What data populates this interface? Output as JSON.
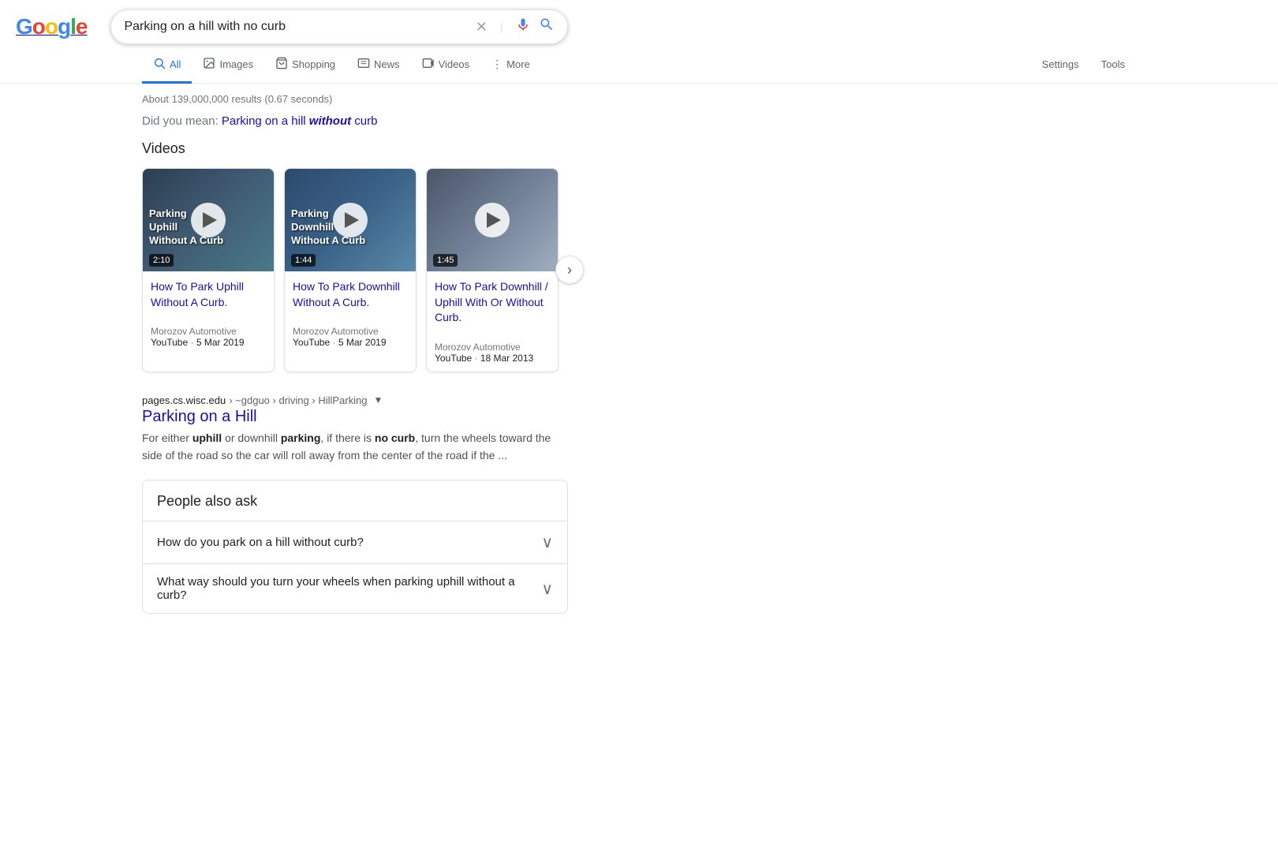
{
  "logo": {
    "letters": [
      "G",
      "o",
      "o",
      "g",
      "l",
      "e"
    ]
  },
  "search": {
    "query": "Parking on a hill with no curb",
    "placeholder": "Search"
  },
  "nav": {
    "items": [
      {
        "label": "All",
        "icon": "🔍",
        "active": true
      },
      {
        "label": "Images",
        "icon": "🖼",
        "active": false
      },
      {
        "label": "Shopping",
        "icon": "🏷",
        "active": false
      },
      {
        "label": "News",
        "icon": "📰",
        "active": false
      },
      {
        "label": "Videos",
        "icon": "▶",
        "active": false
      },
      {
        "label": "More",
        "icon": "⋮",
        "active": false
      }
    ],
    "settings": "Settings",
    "tools": "Tools"
  },
  "results_count": "About 139,000,000 results (0.67 seconds)",
  "did_you_mean": {
    "prefix": "Did you mean:",
    "query_start": "Parking on a hill ",
    "query_bold": "without",
    "query_end": " curb"
  },
  "videos_section": {
    "title": "Videos",
    "cards": [
      {
        "title": "How To Park Uphill Without A Curb.",
        "duration": "2:10",
        "source": "Morozov Automotive",
        "platform": "YouTube",
        "date": "5 Mar 2019",
        "thumb_label1": "Parking",
        "thumb_label2": "Uphill",
        "thumb_label3": "Without A Curb"
      },
      {
        "title": "How To Park Downhill Without A Curb.",
        "duration": "1:44",
        "source": "Morozov Automotive",
        "platform": "YouTube",
        "date": "5 Mar 2019",
        "thumb_label1": "Parking",
        "thumb_label2": "Downhill",
        "thumb_label3": "Without A Curb"
      },
      {
        "title": "How To Park Downhill / Uphill With Or Without Curb.",
        "duration": "1:45",
        "source": "Morozov Automotive",
        "platform": "YouTube",
        "date": "18 Mar 2013",
        "thumb_label1": "",
        "thumb_label2": "",
        "thumb_label3": ""
      }
    ]
  },
  "search_result": {
    "url_domain": "pages.cs.wisc.edu",
    "url_path": "› ~gdguo › driving › HillParking",
    "title": "Parking on a Hill",
    "snippet_start": "For either ",
    "snippet_uphill": "uphill",
    "snippet_mid1": " or downhill ",
    "snippet_parking": "parking",
    "snippet_mid2": ", if there is ",
    "snippet_nocurb": "no curb",
    "snippet_end": ", turn the wheels toward the side of the road so the car will roll away from the center of the road if the ..."
  },
  "paa": {
    "title": "People also ask",
    "questions": [
      "How do you park on a hill without curb?",
      "What way should you turn your wheels when parking uphill without a curb?"
    ]
  }
}
